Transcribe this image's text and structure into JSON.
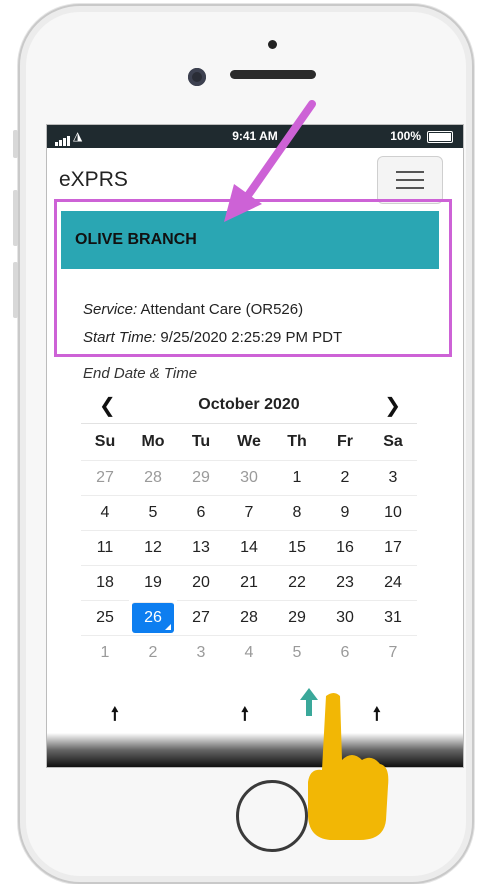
{
  "status_bar": {
    "time": "9:41 AM",
    "battery": "100%"
  },
  "app": {
    "title": "eXPRS"
  },
  "branch": {
    "name": "OLIVE BRANCH"
  },
  "service": {
    "label": "Service:",
    "value": "Attendant Care (OR526)"
  },
  "start_time": {
    "label": "Start Time:",
    "value": "9/25/2020 2:25:29 PM PDT"
  },
  "end_label": "End Date & Time",
  "calendar": {
    "month": "October 2020",
    "weekdays": [
      "Su",
      "Mo",
      "Tu",
      "We",
      "Th",
      "Fr",
      "Sa"
    ],
    "weeks": [
      [
        "27",
        "28",
        "29",
        "30",
        "1",
        "2",
        "3"
      ],
      [
        "4",
        "5",
        "6",
        "7",
        "8",
        "9",
        "10"
      ],
      [
        "11",
        "12",
        "13",
        "14",
        "15",
        "16",
        "17"
      ],
      [
        "18",
        "19",
        "20",
        "21",
        "22",
        "23",
        "24"
      ],
      [
        "25",
        "26",
        "27",
        "28",
        "29",
        "30",
        "31"
      ],
      [
        "1",
        "2",
        "3",
        "4",
        "5",
        "6",
        "7"
      ]
    ],
    "selected_day": "26"
  },
  "icons": {
    "prev": "chevron-left-icon",
    "next": "chevron-right-icon",
    "up_arrows": [
      "up-arrow-icon",
      "up-arrow-icon",
      "up-arrow-icon"
    ]
  },
  "colors": {
    "branch_bar": "#2aa6b3",
    "highlight": "#cd62d6",
    "selected_day": "#0d7ef0",
    "teal_arrow": "#3aa89a",
    "finger": "#f2b705"
  }
}
